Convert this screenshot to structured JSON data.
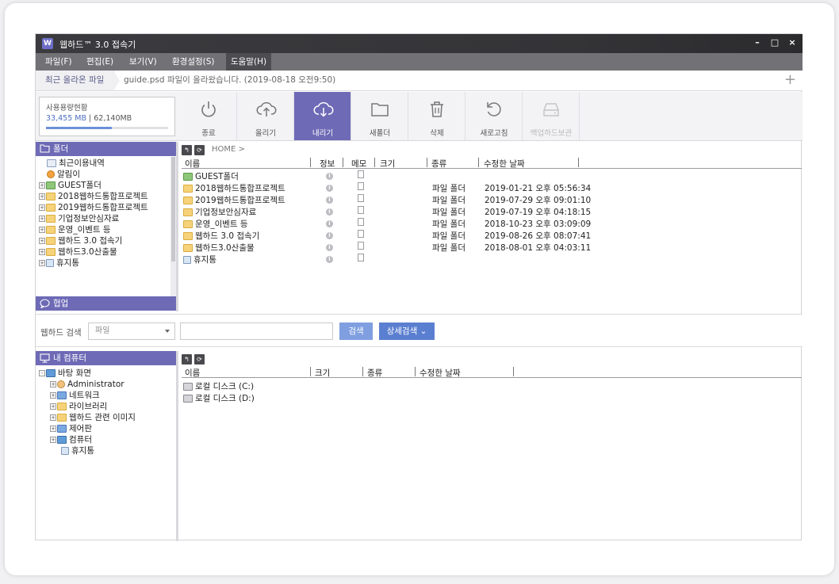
{
  "window": {
    "title": "웹하드™ 3.0 접속기",
    "logo_text": "W",
    "controls": {
      "minimize": "–",
      "maximize": "□",
      "close": "×"
    }
  },
  "menu": [
    {
      "label": "파일(F)"
    },
    {
      "label": "편집(E)"
    },
    {
      "label": "보기(V)"
    },
    {
      "label": "환경설정(S)"
    },
    {
      "label": "도움말(H)"
    }
  ],
  "recent": {
    "tab_label": "최근 올라온 파일",
    "message": "guide.psd 파일이 올라왔습니다. (2019-08-18 오전9:50)",
    "add_icon": "plus-icon"
  },
  "usage": {
    "label": "사용용량현황",
    "used": "33,455 MB",
    "separator": "|",
    "total": "62,140MB",
    "ratio": 0.538
  },
  "toolbar": [
    {
      "label": "종료",
      "icon": "power-icon"
    },
    {
      "label": "올리기",
      "icon": "cloud-upload-icon"
    },
    {
      "label": "내리기",
      "icon": "cloud-download-icon",
      "active": true
    },
    {
      "label": "새폴더",
      "icon": "folder-icon"
    },
    {
      "label": "삭제",
      "icon": "trash-icon"
    },
    {
      "label": "새로고침",
      "icon": "refresh-icon"
    },
    {
      "label": "백업하드보관",
      "icon": "hard-drive-icon",
      "disabled": true
    }
  ],
  "folder_panel": {
    "header": "폴더",
    "tree": [
      {
        "label": "최근이용내역",
        "icon": "recent-icon"
      },
      {
        "label": "알림이",
        "icon": "bell-icon"
      },
      {
        "label": "GUEST폴더",
        "icon": "guest-folder-icon",
        "expand": "+"
      },
      {
        "label": "2018웹하드통합프로젝트",
        "icon": "folder-icon",
        "expand": "+"
      },
      {
        "label": "2019웹하드통합프로젝트",
        "icon": "folder-icon",
        "expand": "+"
      },
      {
        "label": "기업정보안심자료",
        "icon": "folder-icon",
        "expand": "+"
      },
      {
        "label": "운영_이벤트 등",
        "icon": "folder-icon",
        "expand": "+"
      },
      {
        "label": "웹하드 3.0 접속기",
        "icon": "folder-icon",
        "expand": "+"
      },
      {
        "label": "웹하드3.0산출물",
        "icon": "folder-icon",
        "expand": "+"
      },
      {
        "label": "휴지통",
        "icon": "trash-icon",
        "expand": "+"
      }
    ],
    "collab_header": "협업"
  },
  "file_list": {
    "breadcrumb": "HOME >",
    "nav_icons": [
      "back-icon",
      "refresh-icon"
    ],
    "columns": {
      "name": "이름",
      "info": "정보",
      "memo": "메모",
      "size": "크기",
      "type": "종류",
      "modified": "수정한 날짜"
    },
    "rows": [
      {
        "name": "GUEST폴더",
        "icon": "guest-folder-icon",
        "type": "",
        "modified": ""
      },
      {
        "name": "2018웹하드통합프로젝트",
        "icon": "folder-icon",
        "type": "파일 폴더",
        "modified": "2019-01-21 오후 05:56:34"
      },
      {
        "name": "2019웹하드통합프로젝트",
        "icon": "folder-icon",
        "type": "파일 폴더",
        "modified": "2019-07-29 오후 09:01:10"
      },
      {
        "name": "기업정보안심자료",
        "icon": "folder-icon",
        "type": "파일 폴더",
        "modified": "2019-07-19 오후 04:18:15"
      },
      {
        "name": "운영_이벤트 등",
        "icon": "folder-icon",
        "type": "파일 폴더",
        "modified": "2018-10-23 오후 03:09:09"
      },
      {
        "name": "웹하드 3.0 접속기",
        "icon": "folder-icon",
        "type": "파일 폴더",
        "modified": "2019-08-26 오후 08:07:41"
      },
      {
        "name": "웹하드3.0산출물",
        "icon": "folder-icon",
        "type": "파일 폴더",
        "modified": "2018-08-01 오후 04:03:11"
      },
      {
        "name": "휴지통",
        "icon": "trash-icon",
        "type": "",
        "modified": ""
      }
    ]
  },
  "search": {
    "label": "웹하드 검색",
    "select_value": "파일",
    "button": "검색",
    "advanced_button": "상세검색",
    "advanced_icon": "chevron-down-icon"
  },
  "local_panel": {
    "header": "내 컴퓨터",
    "tree": [
      {
        "label": "바탕 화면",
        "icon": "desktop-icon",
        "expand": "-"
      },
      {
        "label": "Administrator",
        "icon": "user-icon",
        "expand": "+"
      },
      {
        "label": "네트워크",
        "icon": "network-icon",
        "expand": "+"
      },
      {
        "label": "라이브러리",
        "icon": "library-icon",
        "expand": "+"
      },
      {
        "label": "웹하드 관련 이미지",
        "icon": "folder-icon",
        "expand": "+"
      },
      {
        "label": "제어판",
        "icon": "control-panel-icon",
        "expand": "+"
      },
      {
        "label": "컴퓨터",
        "icon": "computer-icon",
        "expand": "+"
      },
      {
        "label": "휴지통",
        "icon": "trash-icon"
      }
    ],
    "columns": {
      "name": "이름",
      "size": "크기",
      "type": "종류",
      "modified": "수정한 날짜"
    },
    "rows": [
      {
        "name": "로컬 디스크 (C:)",
        "icon": "system-drive-icon"
      },
      {
        "name": "로컬 디스크 (D:)",
        "icon": "drive-icon"
      }
    ]
  },
  "colors": {
    "accent": "#6e6ab6",
    "titlebar": "#3b3b3f",
    "menubar": "#727276",
    "search_button": "#7f9fe0",
    "advanced_button": "#5b7fd0"
  }
}
